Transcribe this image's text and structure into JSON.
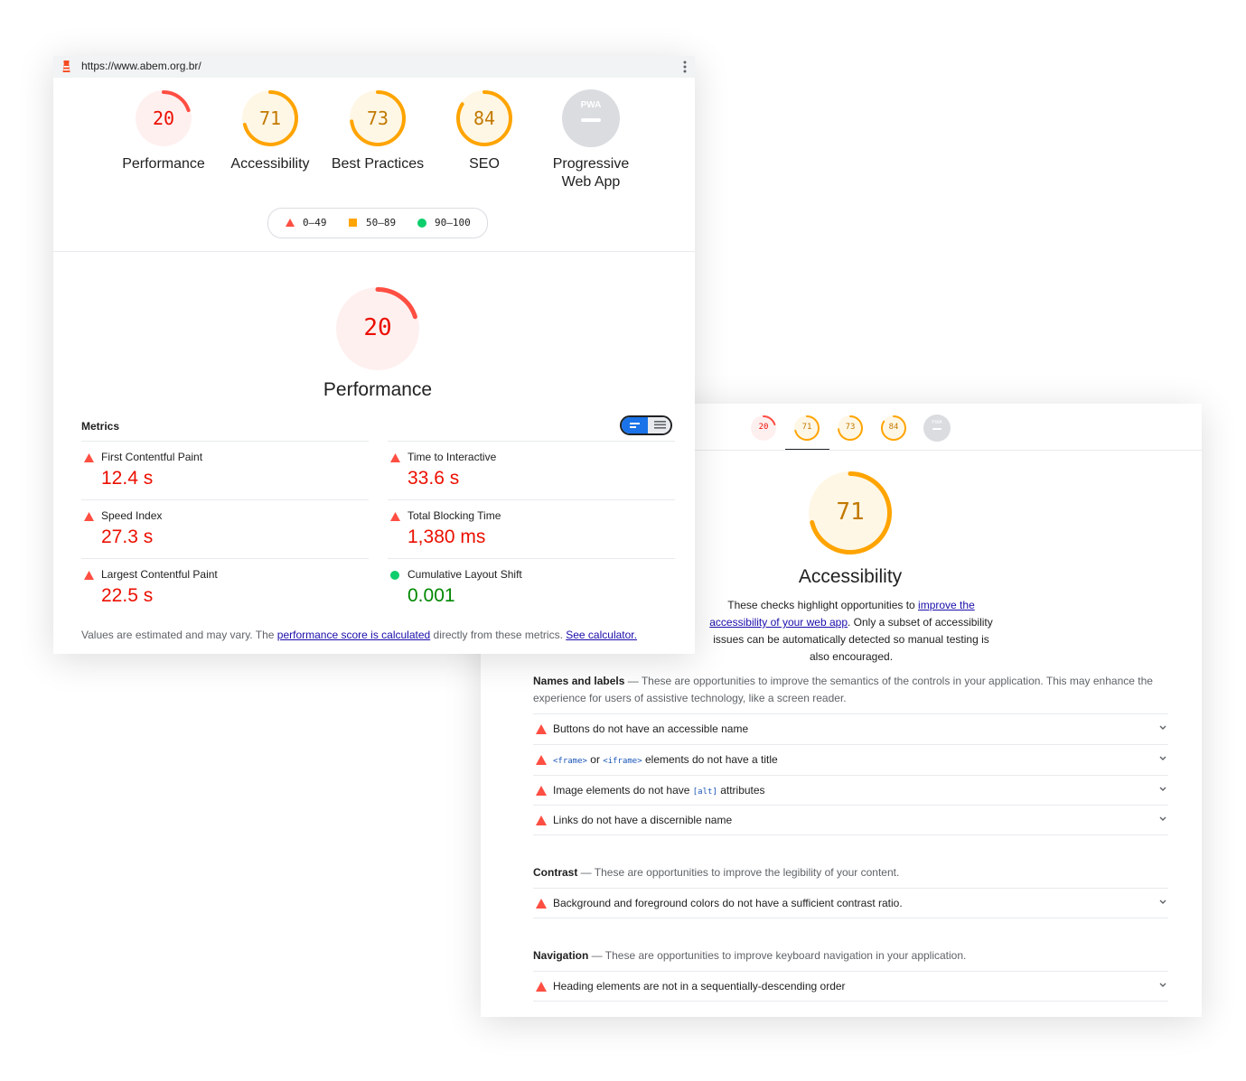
{
  "colors": {
    "fail": "#ff4e42",
    "average": "#ffa400",
    "pass": "#0cce6b",
    "fail_text": "#eb0f00",
    "pass_text": "#008800",
    "fail_bg": "#fff0f0",
    "average_bg": "#fff7e6",
    "pwa_gray": "#dadce0"
  },
  "window1": {
    "url": "https://www.abem.org.br/",
    "gauges": [
      {
        "label": "Performance",
        "score": 20,
        "rating": "fail"
      },
      {
        "label": "Accessibility",
        "score": 71,
        "rating": "average"
      },
      {
        "label": "Best Practices",
        "score": 73,
        "rating": "average"
      },
      {
        "label": "SEO",
        "score": 84,
        "rating": "average"
      }
    ],
    "pwa": {
      "label_line1": "Progressive",
      "label_line2": "Web App",
      "badge": "PWA"
    },
    "legend": {
      "fail": "0–49",
      "average": "50–89",
      "pass": "90–100"
    },
    "main": {
      "score": 20,
      "title": "Performance"
    },
    "metrics_title": "Metrics",
    "metrics": [
      {
        "label": "First Contentful Paint",
        "value": "12.4 s",
        "rating": "fail"
      },
      {
        "label": "Time to Interactive",
        "value": "33.6 s",
        "rating": "fail"
      },
      {
        "label": "Speed Index",
        "value": "27.3 s",
        "rating": "fail"
      },
      {
        "label": "Total Blocking Time",
        "value": "1,380 ms",
        "rating": "fail"
      },
      {
        "label": "Largest Contentful Paint",
        "value": "22.5 s",
        "rating": "fail"
      },
      {
        "label": "Cumulative Layout Shift",
        "value": "0.001",
        "rating": "pass"
      }
    ],
    "note": {
      "pre": "Values are estimated and may vary. The ",
      "link1": "performance score is calculated",
      "mid": " directly from these metrics. ",
      "link2": "See calculator."
    }
  },
  "window2": {
    "mini_scores": [
      {
        "score": 20,
        "rating": "fail"
      },
      {
        "score": 71,
        "rating": "average"
      },
      {
        "score": 73,
        "rating": "average"
      },
      {
        "score": 84,
        "rating": "average"
      }
    ],
    "mini_pwa_badge": "PWA",
    "main": {
      "score": 71,
      "title": "Accessibility"
    },
    "desc": {
      "pre": "These checks highlight opportunities to ",
      "link": "improve the accessibility of your web app",
      "post": ". Only a subset of accessibility issues can be automatically detected so manual testing is also encouraged."
    },
    "groups": [
      {
        "title": "Names and labels",
        "desc": " — These are opportunities to improve the semantics of the controls in your application. This may enhance the experience for users of assistive technology, like a screen reader."
      },
      {
        "title": "Contrast",
        "desc": " — These are opportunities to improve the legibility of your content."
      },
      {
        "title": "Navigation",
        "desc": " — These are opportunities to improve keyboard navigation in your application."
      }
    ],
    "audits": {
      "buttons": "Buttons do not have an accessible name",
      "frame_code1": "<frame>",
      "frame_or": " or ",
      "frame_code2": "<iframe>",
      "frame_rest": " elements do not have a title",
      "image_pre": "Image elements do not have ",
      "image_code": "[alt]",
      "image_post": " attributes",
      "links": "Links do not have a discernible name",
      "contrast": "Background and foreground colors do not have a sufficient contrast ratio.",
      "heading": "Heading elements are not in a sequentially-descending order"
    }
  }
}
